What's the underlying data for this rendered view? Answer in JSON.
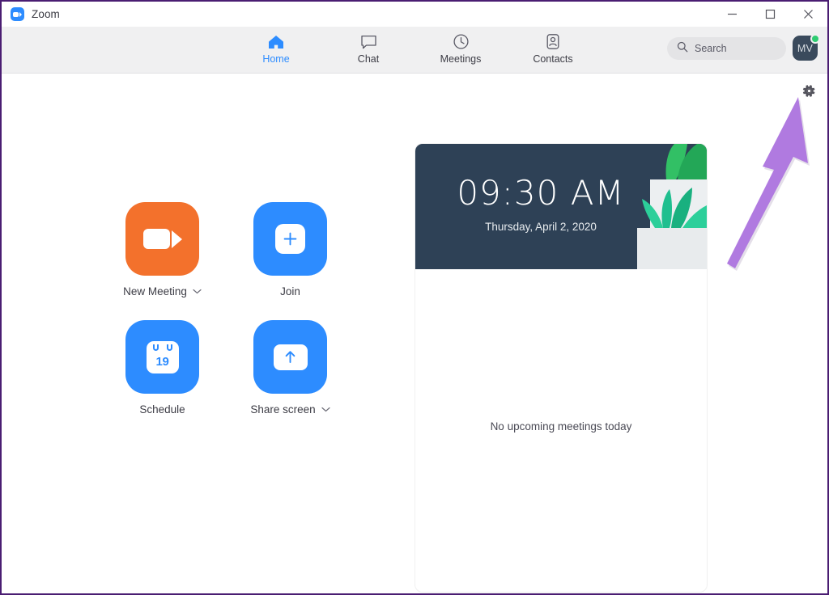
{
  "window": {
    "title": "Zoom",
    "logo_icon": "zoom-camera-icon",
    "controls": [
      {
        "name": "minimize",
        "icon": "minimize-icon"
      },
      {
        "name": "maximize",
        "icon": "maximize-icon"
      },
      {
        "name": "close",
        "icon": "close-icon"
      }
    ],
    "border_color": "#4a1d72"
  },
  "nav": {
    "items": [
      {
        "label": "Home",
        "icon": "home-icon",
        "active": true
      },
      {
        "label": "Chat",
        "icon": "chat-bubble-icon",
        "active": false
      },
      {
        "label": "Meetings",
        "icon": "clock-icon",
        "active": false
      },
      {
        "label": "Contacts",
        "icon": "contacts-person-icon",
        "active": false
      }
    ],
    "active_color": "#2d8cff",
    "background": "#f0f0f1"
  },
  "search": {
    "placeholder": "Search",
    "icon": "search-icon"
  },
  "account": {
    "initials": "MV",
    "status": "online",
    "status_color": "#2ecc71",
    "avatar_color": "#3a4a5c"
  },
  "actions": [
    {
      "label": "New Meeting",
      "icon": "video-camera-icon",
      "color": "#f3712c",
      "has_dropdown": true
    },
    {
      "label": "Join",
      "icon": "plus-square-icon",
      "color": "#2d8cff",
      "has_dropdown": false
    },
    {
      "label": "Schedule",
      "icon": "calendar-icon",
      "color": "#2d8cff",
      "has_dropdown": false,
      "calendar_day": "19"
    },
    {
      "label": "Share screen",
      "icon": "share-screen-arrow-icon",
      "color": "#2d8cff",
      "has_dropdown": true
    }
  ],
  "meetings_card": {
    "time": "09:30 AM",
    "date": "Thursday, April 2, 2020",
    "header_color": "#2e4156",
    "empty_message": "No upcoming meetings today",
    "illustration": "potted-plant-illustration"
  },
  "annotation": {
    "gear_icon": "settings-gear-icon",
    "arrow_icon": "pointer-arrow-annotation",
    "arrow_color": "#b07ae0"
  }
}
